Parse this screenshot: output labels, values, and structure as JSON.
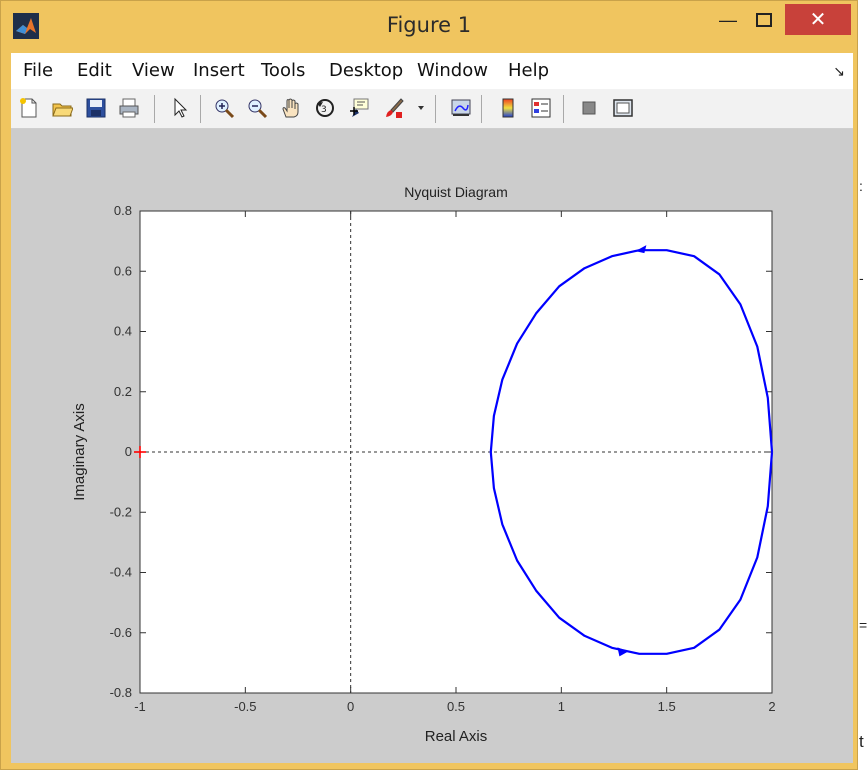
{
  "window": {
    "title": "Figure 1",
    "minimize_glyph": "—",
    "close_glyph": "✕",
    "accent_color": "#f0c55f",
    "close_color": "#c8413a"
  },
  "menu": {
    "items": [
      {
        "name": "file",
        "label": "File"
      },
      {
        "name": "edit",
        "label": "Edit"
      },
      {
        "name": "view",
        "label": "View"
      },
      {
        "name": "insert",
        "label": "Insert"
      },
      {
        "name": "tools",
        "label": "Tools"
      },
      {
        "name": "desktop",
        "label": "Desktop"
      },
      {
        "name": "window",
        "label": "Window"
      },
      {
        "name": "help",
        "label": "Help"
      }
    ],
    "dock_glyph": "↘"
  },
  "toolbar": {
    "icons": [
      "new-figure-icon",
      "open-file-icon",
      "save-icon",
      "print-icon",
      "edit-plot-arrow-icon",
      "zoom-in-icon",
      "zoom-out-icon",
      "pan-hand-icon",
      "rotate-3d-icon",
      "data-cursor-icon",
      "brush-icon",
      "brush-dropdown-icon",
      "link-plot-icon",
      "colorbar-icon",
      "legend-icon",
      "hide-plot-tools-icon",
      "show-plot-tools-icon"
    ]
  },
  "chart_data": {
    "type": "line",
    "title": "Nyquist Diagram",
    "xlabel": "Real Axis",
    "ylabel": "Imaginary Axis",
    "xlim": [
      -1,
      2
    ],
    "ylim": [
      -0.8,
      0.8
    ],
    "xticks": [
      -1,
      -0.5,
      0,
      0.5,
      1,
      1.5,
      2
    ],
    "yticks": [
      0.8,
      0.6,
      0.4,
      0.2,
      0,
      -0.2,
      -0.4,
      -0.6,
      -0.8
    ],
    "xtick_labels": [
      "-1",
      "-0.5",
      "0",
      "0.5",
      "1",
      "1.5",
      "2"
    ],
    "ytick_labels": [
      "0.8",
      "0.6",
      "0.4",
      "0.2",
      "0",
      "-0.2",
      "-0.4",
      "-0.6",
      "-0.8"
    ],
    "grid": false,
    "series": [
      {
        "color": "#0000ff",
        "x": [
          2.0,
          1.98,
          1.93,
          1.85,
          1.75,
          1.63,
          1.5,
          1.37,
          1.24,
          1.11,
          0.99,
          0.88,
          0.79,
          0.72,
          0.68,
          0.665,
          0.68,
          0.72,
          0.79,
          0.88,
          0.99,
          1.11,
          1.24,
          1.37,
          1.5,
          1.63,
          1.75,
          1.85,
          1.93,
          1.98,
          2.0
        ],
        "y": [
          0.0,
          0.18,
          0.35,
          0.49,
          0.59,
          0.65,
          0.67,
          0.67,
          0.65,
          0.61,
          0.55,
          0.46,
          0.36,
          0.24,
          0.12,
          0.0,
          -0.12,
          -0.24,
          -0.36,
          -0.46,
          -0.55,
          -0.61,
          -0.65,
          -0.67,
          -0.67,
          -0.65,
          -0.59,
          -0.49,
          -0.35,
          -0.18,
          0.0
        ]
      }
    ],
    "arrows": [
      {
        "x": 1.38,
        "y": 0.67,
        "direction": "left"
      },
      {
        "x": 1.29,
        "y": -0.665,
        "direction": "right"
      }
    ],
    "critical_point": {
      "x": -1,
      "y": 0,
      "color": "#ff0000"
    },
    "reference_lines": [
      {
        "axis": "x",
        "value": 0
      },
      {
        "axis": "y",
        "value": 0
      }
    ]
  }
}
